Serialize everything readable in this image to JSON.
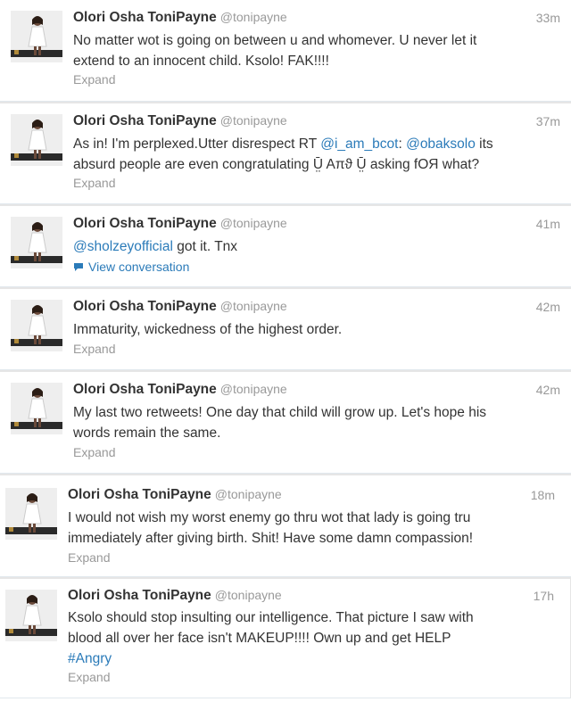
{
  "tweets": [
    {
      "name": "Olori Osha ToniPayne",
      "handle": "@tonipayne",
      "time": "33m",
      "lines": [
        "No matter wot is going on between u and whomever. U never let it",
        "extend to an innocent child. Ksolo! FAK!!!!"
      ],
      "action": "Expand"
    },
    {
      "name": "Olori Osha ToniPayne",
      "handle": "@tonipayne",
      "time": "37m",
      "line1_a": "As in! I'm perplexed.Utter disrespect RT ",
      "mention1": "@i_am_bcot",
      "line1_b": ": ",
      "mention2": "@obaksolo",
      "line1_c": " its",
      "line2": "absurd people are even congratulating Ṳ̄ Aπϑ Ṳ̄ asking fOЯ what?",
      "action": "Expand"
    },
    {
      "name": "Olori Osha ToniPayne",
      "handle": "@tonipayne",
      "time": "41m",
      "mention": "@sholzeyofficial",
      "rest": " got it. Tnx",
      "action": "View conversation"
    },
    {
      "name": "Olori Osha ToniPayne",
      "handle": "@tonipayne",
      "time": "42m",
      "lines": [
        "Immaturity, wickedness of the highest order."
      ],
      "action": "Expand"
    },
    {
      "name": "Olori Osha ToniPayne",
      "handle": "@tonipayne",
      "time": "42m",
      "lines": [
        "My last two retweets! One day that child will grow up. Let's hope his",
        "words remain the same."
      ],
      "action": "Expand"
    },
    {
      "name": "Olori Osha ToniPayne",
      "handle": "@tonipayne",
      "time": "18m",
      "lines": [
        "I would not wish my worst enemy go thru wot that lady is going tru",
        "immediately after giving birth. Shit! Have some damn compassion!"
      ],
      "action": "Expand"
    },
    {
      "name": "Olori Osha ToniPayne",
      "handle": "@tonipayne",
      "time": "17h",
      "lines": [
        "Ksolo should stop insulting our intelligence. That picture I saw with",
        "blood all over her face isn't MAKEUP!!!! Own up and get HELP"
      ],
      "hashtag": "#Angry",
      "action": "Expand"
    }
  ],
  "colors": {
    "link": "#2b7bb9",
    "muted": "#999999",
    "text": "#333333"
  }
}
